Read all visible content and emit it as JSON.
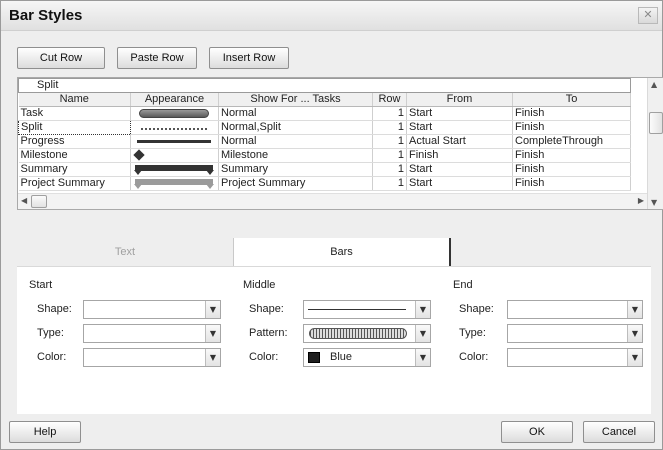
{
  "dialog": {
    "title": "Bar Styles",
    "close_glyph": "✕"
  },
  "toolbar": {
    "cut_row": "Cut Row",
    "paste_row": "Paste Row",
    "insert_row": "Insert Row"
  },
  "grid": {
    "edit_value": "Split",
    "columns": [
      "Name",
      "Appearance",
      "Show For ... Tasks",
      "Row",
      "From",
      "To"
    ],
    "rows": [
      {
        "name": "Task",
        "appearance": "rounded-bar",
        "show_for": "Normal",
        "row": "1",
        "from": "Start",
        "to": "Finish"
      },
      {
        "name": "Split",
        "appearance": "dotted-line",
        "show_for": "Normal,Split",
        "row": "1",
        "from": "Start",
        "to": "Finish"
      },
      {
        "name": "Progress",
        "appearance": "thin-bar",
        "show_for": "Normal",
        "row": "1",
        "from": "Actual Start",
        "to": "CompleteThrough"
      },
      {
        "name": "Milestone",
        "appearance": "diamond",
        "show_for": "Milestone",
        "row": "1",
        "from": "Finish",
        "to": "Finish"
      },
      {
        "name": "Summary",
        "appearance": "summary-bar",
        "show_for": "Summary",
        "row": "1",
        "from": "Start",
        "to": "Finish"
      },
      {
        "name": "Project Summary",
        "appearance": "project-summary-bar",
        "show_for": "Project Summary",
        "row": "1",
        "from": "Start",
        "to": "Finish"
      }
    ]
  },
  "tabs": {
    "text": "Text",
    "bars": "Bars"
  },
  "start": {
    "heading": "Start",
    "shape_label": "Shape:",
    "type_label": "Type:",
    "color_label": "Color:"
  },
  "middle": {
    "heading": "Middle",
    "shape_label": "Shape:",
    "pattern_label": "Pattern:",
    "color_label": "Color:",
    "color_value": "Blue"
  },
  "end": {
    "heading": "End",
    "shape_label": "Shape:",
    "type_label": "Type:",
    "color_label": "Color:"
  },
  "footer": {
    "help": "Help",
    "ok": "OK",
    "cancel": "Cancel"
  }
}
